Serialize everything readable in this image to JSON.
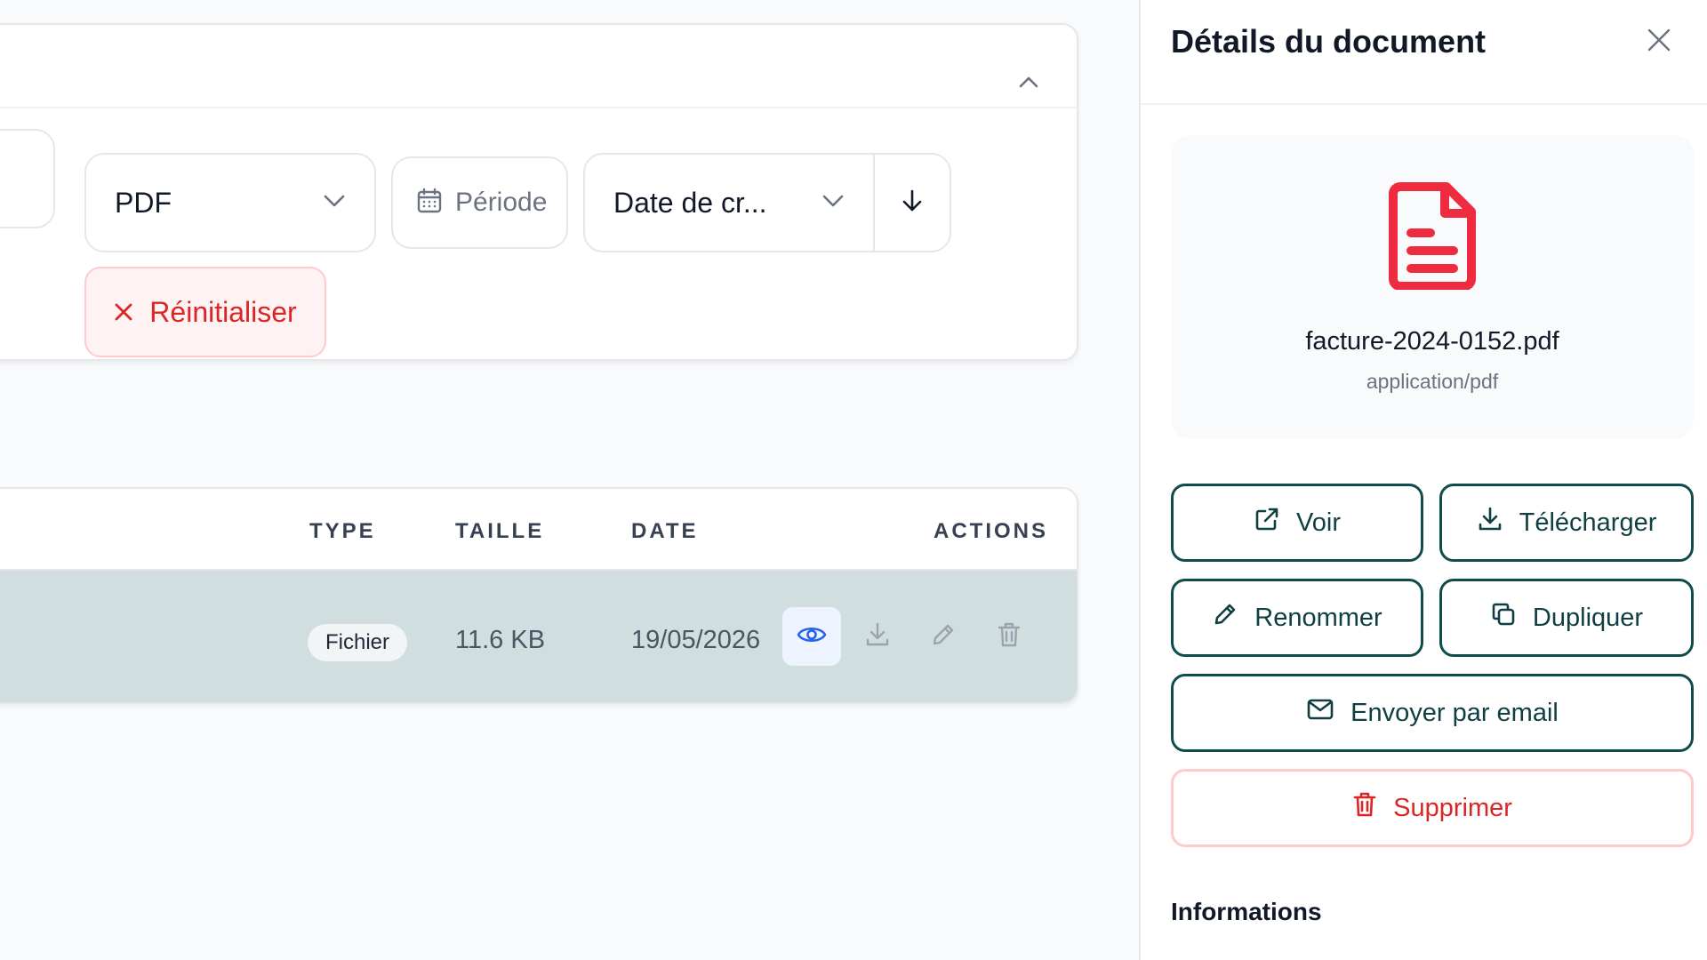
{
  "filters": {
    "type_value": "PDF",
    "period_placeholder": "Période",
    "sort_value": "Date de cr...",
    "reset_label": "Réinitialiser"
  },
  "table": {
    "headers": {
      "type": "TYPE",
      "size": "TAILLE",
      "date": "DATE",
      "actions": "ACTIONS"
    },
    "row": {
      "type_badge": "Fichier",
      "size": "11.6 KB",
      "date": "19/05/2026"
    }
  },
  "panel": {
    "title": "Détails du document",
    "file_name": "facture-2024-0152.pdf",
    "mime_type": "application/pdf",
    "buttons": {
      "view": "Voir",
      "download": "Télécharger",
      "rename": "Renommer",
      "duplicate": "Dupliquer",
      "email": "Envoyer par email",
      "delete": "Supprimer"
    },
    "section_informations": "Informations"
  },
  "icons": {
    "collapse": "chevron-up-icon",
    "dropdown": "chevron-down-icon",
    "calendar": "calendar-icon",
    "sort_direction": "arrow-down-icon",
    "reset": "x-icon",
    "view": "eye-icon",
    "download": "download-icon",
    "edit": "pencil-icon",
    "delete": "trash-icon",
    "close": "close-icon",
    "file": "pdf-file-icon",
    "external_link": "external-link-icon",
    "copy": "copy-icon",
    "mail": "mail-icon"
  },
  "colors": {
    "accent_teal": "#0f4c4c",
    "danger": "#dc2626",
    "danger_border": "#fecaca",
    "danger_bg": "#fef2f2",
    "row_highlight": "#d0dedf",
    "active_action": "#2563eb",
    "file_icon": "#ef2b3f"
  }
}
